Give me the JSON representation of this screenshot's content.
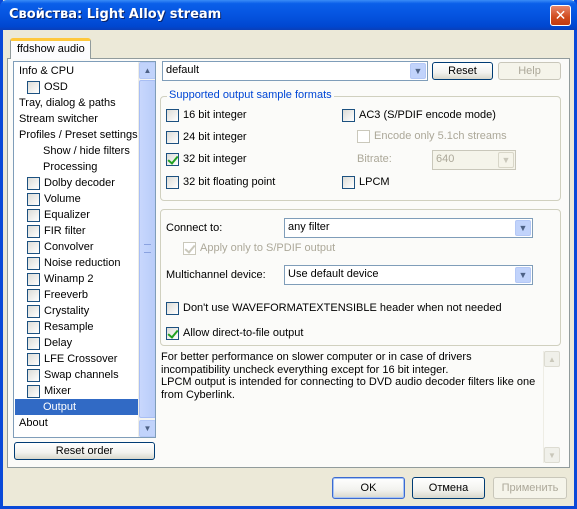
{
  "window": {
    "title": "Свойства: Light Alloy stream",
    "close_glyph": "✕"
  },
  "tab": {
    "label": "ffdshow audio"
  },
  "tree": {
    "items": [
      {
        "label": "Info & CPU",
        "indent": 0,
        "checkbox": false
      },
      {
        "label": "OSD",
        "indent": 1,
        "checkbox": true,
        "checked": false
      },
      {
        "label": "Tray, dialog & paths",
        "indent": 0,
        "checkbox": false
      },
      {
        "label": "Stream switcher",
        "indent": 0,
        "checkbox": false
      },
      {
        "label": "Profiles / Preset settings",
        "indent": 0,
        "checkbox": false
      },
      {
        "label": "Show / hide filters",
        "indent": 2,
        "checkbox": false
      },
      {
        "label": "Processing",
        "indent": 2,
        "checkbox": false
      },
      {
        "label": "Dolby decoder",
        "indent": 1,
        "checkbox": true,
        "checked": false
      },
      {
        "label": "Volume",
        "indent": 1,
        "checkbox": true,
        "checked": false
      },
      {
        "label": "Equalizer",
        "indent": 1,
        "checkbox": true,
        "checked": false
      },
      {
        "label": "FIR filter",
        "indent": 1,
        "checkbox": true,
        "checked": false
      },
      {
        "label": "Convolver",
        "indent": 1,
        "checkbox": true,
        "checked": false
      },
      {
        "label": "Noise reduction",
        "indent": 1,
        "checkbox": true,
        "checked": false
      },
      {
        "label": "Winamp 2",
        "indent": 1,
        "checkbox": true,
        "checked": false
      },
      {
        "label": "Freeverb",
        "indent": 1,
        "checkbox": true,
        "checked": false
      },
      {
        "label": "Crystality",
        "indent": 1,
        "checkbox": true,
        "checked": false
      },
      {
        "label": "Resample",
        "indent": 1,
        "checkbox": true,
        "checked": false
      },
      {
        "label": "Delay",
        "indent": 1,
        "checkbox": true,
        "checked": false
      },
      {
        "label": "LFE Crossover",
        "indent": 1,
        "checkbox": true,
        "checked": false
      },
      {
        "label": "Swap channels",
        "indent": 1,
        "checkbox": true,
        "checked": false
      },
      {
        "label": "Mixer",
        "indent": 1,
        "checkbox": true,
        "checked": false
      },
      {
        "label": "Output",
        "indent": 2,
        "checkbox": false,
        "selected": true
      },
      {
        "label": "About",
        "indent": 0,
        "checkbox": false
      }
    ],
    "reset_order_label": "Reset order"
  },
  "preset": {
    "value": "default",
    "reset_label": "Reset",
    "help_label": "Help"
  },
  "formats": {
    "title": "Supported output sample formats",
    "f16": "16 bit integer",
    "f24": "24 bit integer",
    "f32": "32 bit integer",
    "ffloat": "32 bit floating point",
    "ac3": "AC3 (S/PDIF encode mode)",
    "ac3_only51": "Encode only 5.1ch streams",
    "bitrate_label": "Bitrate:",
    "bitrate_value": "640",
    "lpcm": "LPCM"
  },
  "connect": {
    "label": "Connect to:",
    "value": "any filter",
    "spdif_only": "Apply only to S/PDIF output",
    "multichannel_label": "Multichannel device:",
    "multichannel_value": "Use default device",
    "no_wfx": "Don't use WAVEFORMATEXTENSIBLE header when not needed",
    "direct_file": "Allow direct-to-file output"
  },
  "info": {
    "line1": "For better performance on slower computer or in case of drivers",
    "line2": "incompatibility uncheck everything except for 16 bit integer.",
    "line3": "LPCM output is intended for connecting to DVD audio decoder filters like one",
    "line4": "from Cyberlink."
  },
  "buttons": {
    "ok": "OK",
    "cancel": "Отмена",
    "apply": "Применить"
  }
}
